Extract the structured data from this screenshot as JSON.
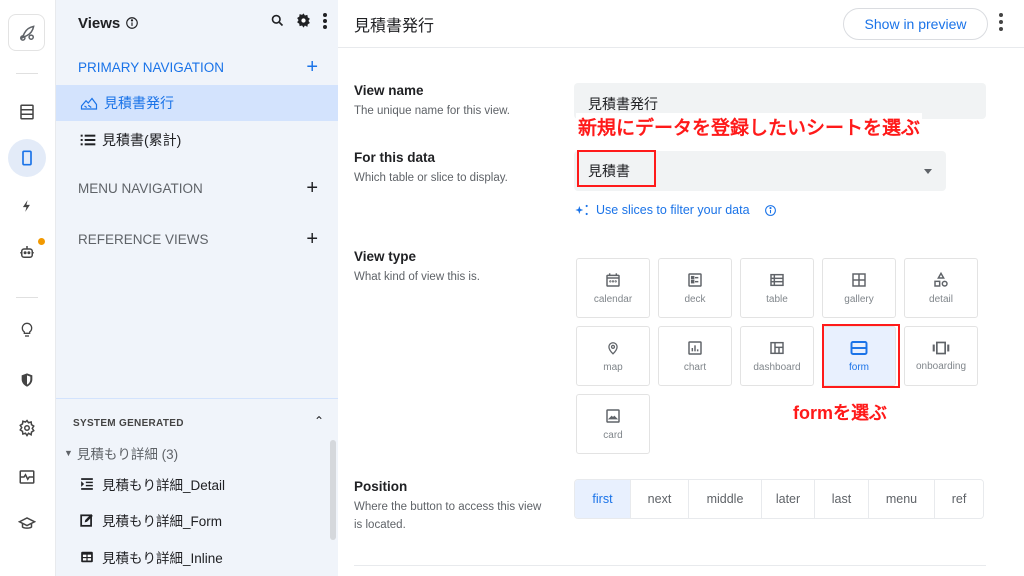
{
  "rail": {
    "items": [
      {
        "icon": "table-data-icon"
      },
      {
        "icon": "mobile-views-icon",
        "active": true
      },
      {
        "icon": "bolt-automation-icon"
      },
      {
        "icon": "bot-icon",
        "badge": true
      },
      {
        "icon": "lightbulb-icon"
      },
      {
        "icon": "security-shield-icon"
      },
      {
        "icon": "settings-icon"
      },
      {
        "icon": "monitor-icon"
      },
      {
        "icon": "learn-icon"
      }
    ]
  },
  "sidebar": {
    "title": "Views",
    "sections": {
      "primary": "PRIMARY NAVIGATION",
      "menu": "MENU NAVIGATION",
      "reference": "REFERENCE VIEWS"
    },
    "primary_items": [
      {
        "label": "見積書発行",
        "selected": true
      },
      {
        "label": "見積書(累計)",
        "selected": false
      }
    ],
    "system": {
      "title": "SYSTEM GENERATED",
      "group": "見積もり詳細 (3)",
      "items": [
        {
          "label": "見積もり詳細_Detail",
          "icon": "detail-view-icon"
        },
        {
          "label": "見積もり詳細_Form",
          "icon": "edit-form-icon"
        },
        {
          "label": "見積もり詳細_Inline",
          "icon": "inline-table-icon"
        }
      ]
    }
  },
  "main": {
    "title": "見積書発行",
    "show_in_preview": "Show in preview",
    "view_name": {
      "label": "View name",
      "desc": "The unique name for this view.",
      "value": "見積書発行"
    },
    "for_this_data": {
      "label": "For this data",
      "desc": "Which table or slice to display.",
      "value": "見積書"
    },
    "slices_link": "Use slices to filter your data",
    "view_type": {
      "label": "View type",
      "desc": "What kind of view this is.",
      "options": [
        "calendar",
        "deck",
        "table",
        "gallery",
        "detail",
        "map",
        "chart",
        "dashboard",
        "form",
        "onboarding",
        "card"
      ],
      "selected": "form"
    },
    "position": {
      "label": "Position",
      "desc": "Where the button to access this view is located.",
      "options": [
        "first",
        "next",
        "middle",
        "later",
        "last",
        "menu",
        "ref"
      ],
      "selected": "first"
    }
  },
  "annotations": {
    "data_note": "新規にデータを登録したいシートを選ぶ",
    "form_note": "formを選ぶ",
    "color": "#ff1a1a"
  }
}
